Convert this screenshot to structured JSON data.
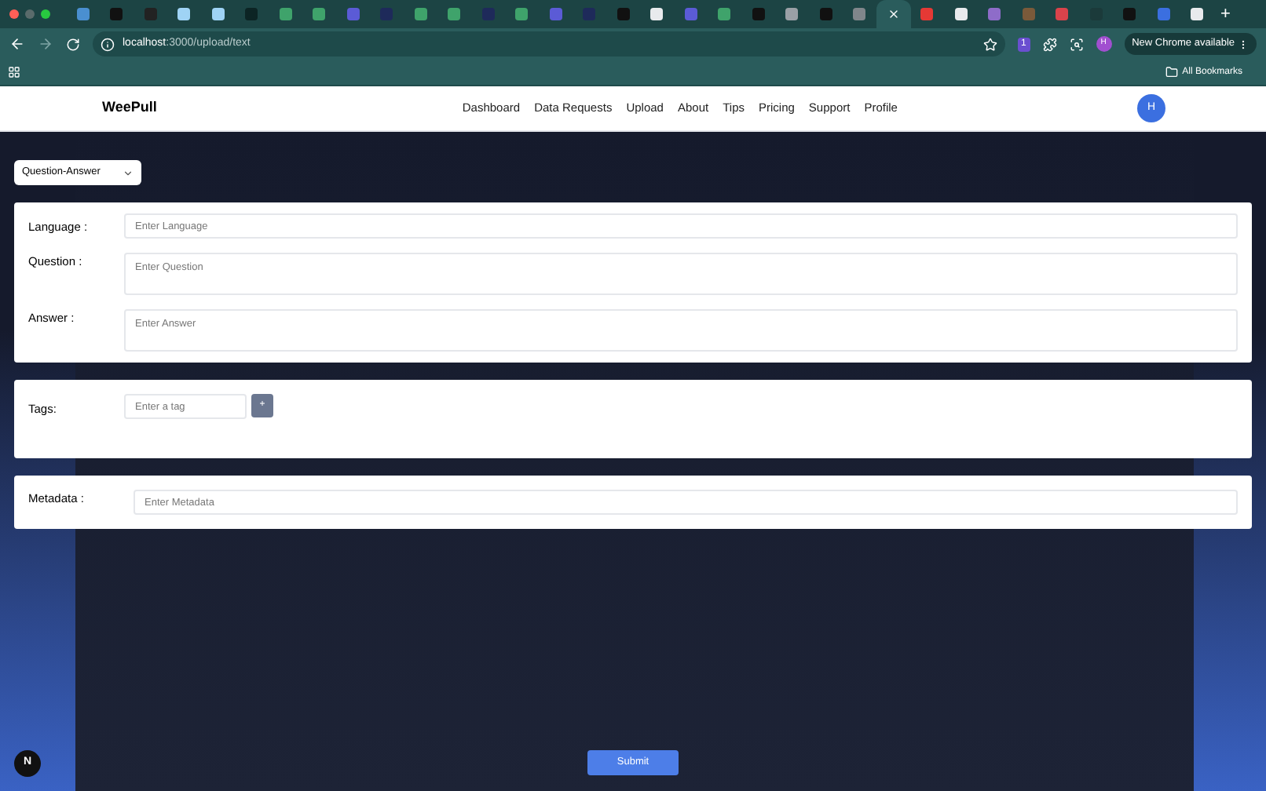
{
  "browser": {
    "tabs": [
      {
        "color": "#4a8fd0",
        "selected": false
      },
      {
        "color": "#111111",
        "selected": false
      },
      {
        "color": "#222222",
        "selected": false
      },
      {
        "color": "#9fd3f5",
        "selected": false
      },
      {
        "color": "#9fd3f5",
        "selected": false
      },
      {
        "color": "#0c2424",
        "selected": false
      },
      {
        "color": "#3fa36b",
        "selected": false
      },
      {
        "color": "#3fa36b",
        "selected": false
      },
      {
        "color": "#5b5bd6",
        "selected": false
      },
      {
        "color": "#1e2a5a",
        "selected": false
      },
      {
        "color": "#3fa36b",
        "selected": false
      },
      {
        "color": "#3fa36b",
        "selected": false
      },
      {
        "color": "#1e2a5a",
        "selected": false
      },
      {
        "color": "#3fa36b",
        "selected": false
      },
      {
        "color": "#5b5bd6",
        "selected": false
      },
      {
        "color": "#1e2a5a",
        "selected": false
      },
      {
        "color": "#111111",
        "selected": false
      },
      {
        "color": "#e8eaed",
        "selected": false
      },
      {
        "color": "#5b5bd6",
        "selected": false
      },
      {
        "color": "#3fa36b",
        "selected": false
      },
      {
        "color": "#111111",
        "selected": false
      },
      {
        "color": "#9aa0a6",
        "selected": false
      },
      {
        "color": "#111111",
        "selected": false
      },
      {
        "color": "#80868b",
        "selected": false
      },
      {
        "selected": true
      },
      {
        "color": "#e53935",
        "selected": false
      },
      {
        "color": "#e8eaed",
        "selected": false
      },
      {
        "color": "#8e6cc9",
        "selected": false
      },
      {
        "color": "#7a5a3a",
        "selected": false
      },
      {
        "color": "#d9434b",
        "selected": false
      },
      {
        "color": "#1b3a3a",
        "selected": false
      },
      {
        "color": "#111111",
        "selected": false
      },
      {
        "color": "#3b6fe0",
        "selected": false
      },
      {
        "color": "#e8eaed",
        "selected": false
      }
    ],
    "new_tab": "+",
    "address": "**localhost**:3000/upload/text",
    "extension_badge": "1",
    "profile": "H",
    "update_chip": "New Chrome available",
    "bookmarks": "All Bookmarks"
  },
  "navbar": {
    "brand": "WeePull",
    "links": [
      "Dashboard",
      "Data Requests",
      "Upload",
      "About",
      "Tips",
      "Pricing",
      "Support",
      "Profile"
    ],
    "avatar": "H"
  },
  "type_select": {
    "value": "Question-Answer"
  },
  "qa_card": {
    "fields": [
      {
        "label": "Language :",
        "placeholder": "Enter Language",
        "kind": "input"
      },
      {
        "label": "Question :",
        "placeholder": "Enter Question",
        "kind": "textarea"
      },
      {
        "label": "Answer :",
        "placeholder": "Enter Answer",
        "kind": "textarea"
      }
    ]
  },
  "tags_card": {
    "label": "Tags:",
    "placeholder": "Enter a tag",
    "add": "+"
  },
  "metadata_card": {
    "label": "Metadata :",
    "placeholder": "Enter Metadata"
  },
  "submit": "Submit",
  "dev_badge": "N"
}
